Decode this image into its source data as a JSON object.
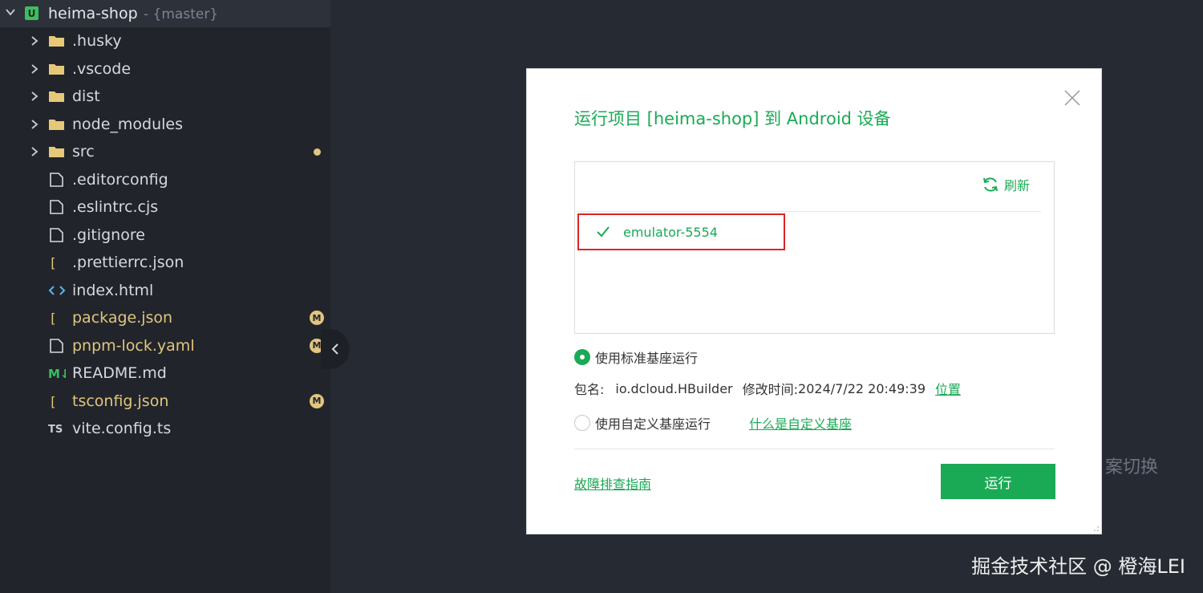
{
  "project": {
    "name": "heima-shop",
    "branch": "- {master}"
  },
  "tree": [
    {
      "name": ".husky",
      "type": "folder",
      "status": ""
    },
    {
      "name": ".vscode",
      "type": "folder",
      "status": ""
    },
    {
      "name": "dist",
      "type": "folder",
      "status": ""
    },
    {
      "name": "node_modules",
      "type": "folder",
      "status": ""
    },
    {
      "name": "src",
      "type": "folder",
      "status": "dot"
    },
    {
      "name": ".editorconfig",
      "type": "file",
      "status": ""
    },
    {
      "name": ".eslintrc.cjs",
      "type": "file",
      "status": ""
    },
    {
      "name": ".gitignore",
      "type": "file",
      "status": ""
    },
    {
      "name": ".prettierrc.json",
      "type": "json",
      "status": ""
    },
    {
      "name": "index.html",
      "type": "html",
      "status": ""
    },
    {
      "name": "package.json",
      "type": "json",
      "status": "M"
    },
    {
      "name": "pnpm-lock.yaml",
      "type": "file",
      "status": "M"
    },
    {
      "name": "README.md",
      "type": "md",
      "status": ""
    },
    {
      "name": "tsconfig.json",
      "type": "json",
      "status": "M"
    },
    {
      "name": "vite.config.ts",
      "type": "ts",
      "status": ""
    }
  ],
  "dialog": {
    "title": "运行项目 [heima-shop] 到 Android 设备",
    "refresh_label": "刷新",
    "device": "emulator-5554",
    "standard_base_label": "使用标准基座运行",
    "package_label": "包名:",
    "package_value": "io.dcloud.HBuilder",
    "modified_label": "修改时间:",
    "modified_value": "2024/7/22 20:49:39",
    "location_link": "位置",
    "custom_base_label": "使用自定义基座运行",
    "custom_base_help_link": "什么是自定义基座",
    "troubleshoot_link": "故障排查指南",
    "run_label": "运行"
  },
  "background": {
    "partial_text": "案切换"
  },
  "watermark": "掘金技术社区 @ 橙海LEI",
  "colors": {
    "accent": "#1aaa55",
    "highlight_border": "#e02424",
    "modified": "#e2c57f"
  }
}
